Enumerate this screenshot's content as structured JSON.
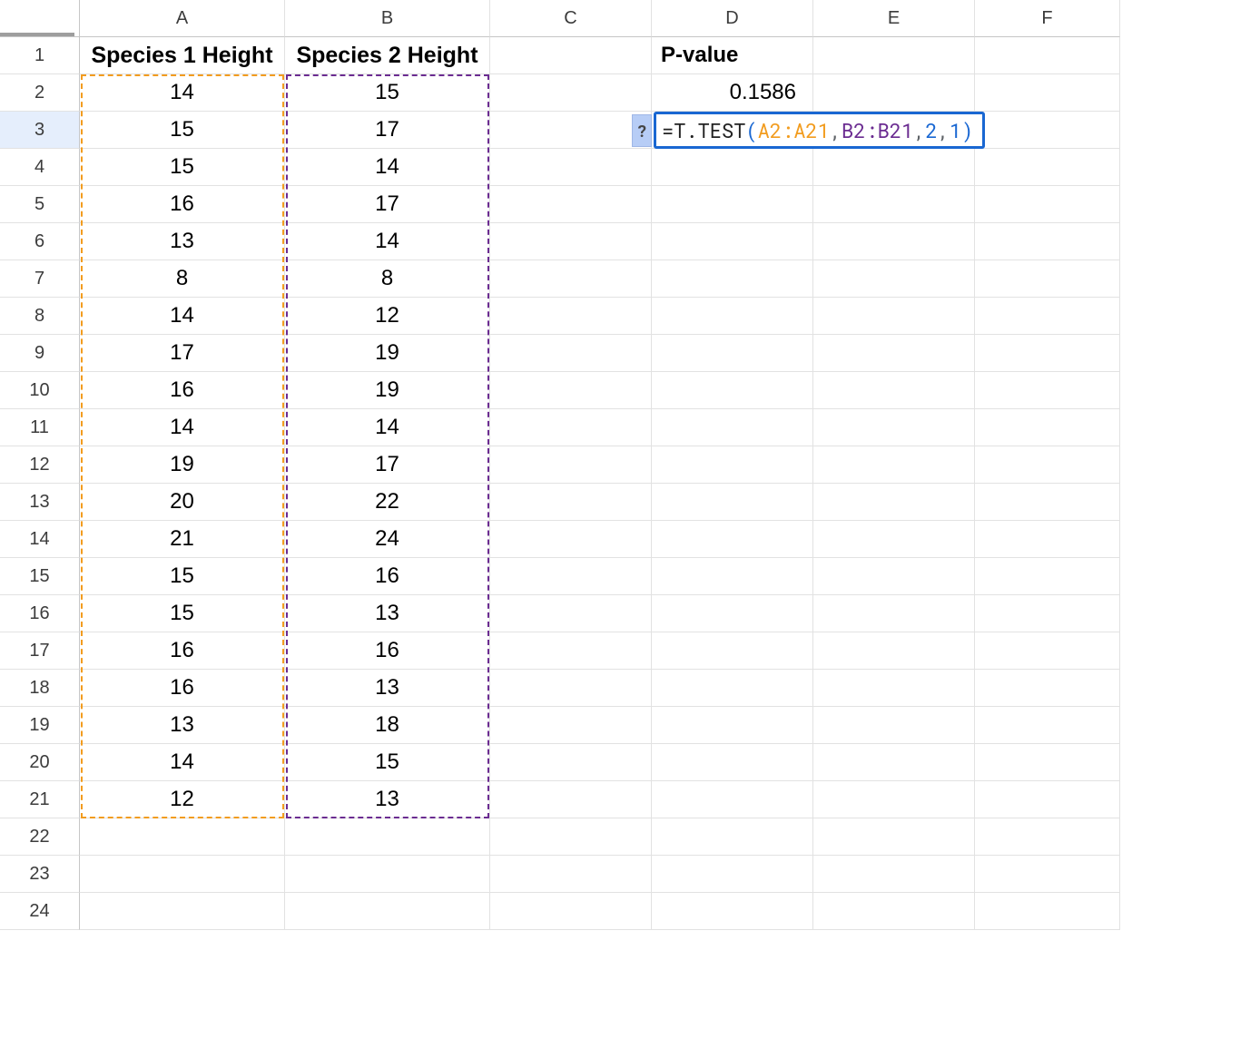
{
  "columns": [
    "A",
    "B",
    "C",
    "D",
    "E",
    "F"
  ],
  "rows": [
    "1",
    "2",
    "3",
    "4",
    "5",
    "6",
    "7",
    "8",
    "9",
    "10",
    "11",
    "12",
    "13",
    "14",
    "15",
    "16",
    "17",
    "18",
    "19",
    "20",
    "21",
    "22",
    "23",
    "24"
  ],
  "headers": {
    "A": "Species 1 Height",
    "B": "Species 2 Height",
    "D": "P-value"
  },
  "dataA": [
    "14",
    "15",
    "15",
    "16",
    "13",
    "8",
    "14",
    "17",
    "16",
    "14",
    "19",
    "20",
    "21",
    "15",
    "15",
    "16",
    "16",
    "13",
    "14",
    "12"
  ],
  "dataB": [
    "15",
    "17",
    "14",
    "17",
    "14",
    "8",
    "12",
    "19",
    "19",
    "14",
    "17",
    "22",
    "24",
    "16",
    "13",
    "16",
    "13",
    "18",
    "15",
    "13"
  ],
  "pvalue": "0.1586",
  "formula": {
    "prefix": "=T.TEST",
    "open": "(",
    "rngA": "A2:A21",
    "c1": ", ",
    "rngB": "B2:B21",
    "c2": ", ",
    "n1": "2",
    "c3": ", ",
    "n2": "1",
    "close": ")"
  },
  "help": "?",
  "colors": {
    "rangeA": "#f29c1f",
    "rangeB": "#6b2c91",
    "formulaBorder": "#1967d2"
  }
}
